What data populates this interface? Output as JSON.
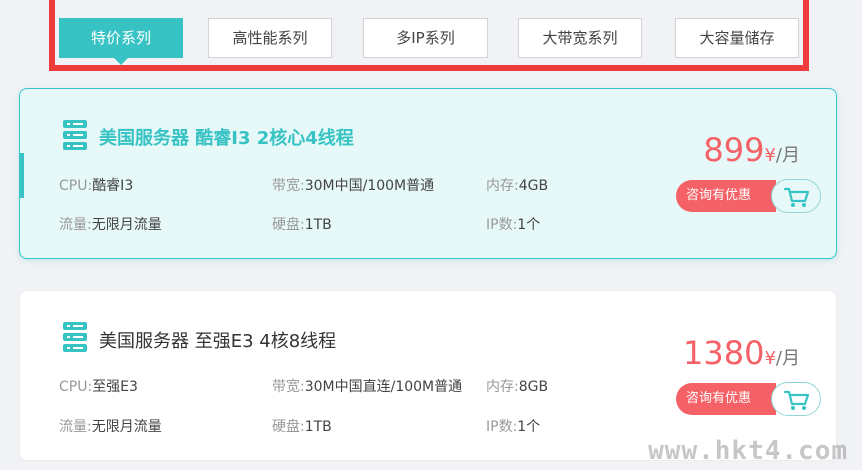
{
  "tabs": [
    {
      "label": "特价系列",
      "active": true
    },
    {
      "label": "高性能系列",
      "active": false
    },
    {
      "label": "多IP系列",
      "active": false
    },
    {
      "label": "大带宽系列",
      "active": false
    },
    {
      "label": "大容量储存",
      "active": false
    }
  ],
  "products": [
    {
      "title": "美国服务器 酷睿I3 2核心4线程",
      "cpu_label": "CPU:",
      "cpu": "酷睿I3",
      "bandwidth_label": "带宽:",
      "bandwidth": "30M中国/100M普通",
      "memory_label": "内存:",
      "memory": "4GB",
      "traffic_label": "流量:",
      "traffic": "无限月流量",
      "disk_label": "硬盘:",
      "disk": "1TB",
      "ip_label": "IP数:",
      "ip": "1个",
      "price": "899",
      "currency": "¥",
      "per": "/月",
      "consult_label": "咨询有优惠"
    },
    {
      "title": "美国服务器 至强E3 4核8线程",
      "cpu_label": "CPU:",
      "cpu": "至强E3",
      "bandwidth_label": "带宽:",
      "bandwidth": "30M中国直连/100M普通",
      "memory_label": "内存:",
      "memory": "8GB",
      "traffic_label": "流量:",
      "traffic": "无限月流量",
      "disk_label": "硬盘:",
      "disk": "1TB",
      "ip_label": "IP数:",
      "ip": "1个",
      "price": "1380",
      "currency": "¥",
      "per": "/月",
      "consult_label": "咨询有优惠"
    }
  ],
  "watermark": "www.hkt4.com",
  "colors": {
    "accent": "#37c3c4",
    "price": "#f46166",
    "highlight_frame": "#ee3b3b"
  }
}
